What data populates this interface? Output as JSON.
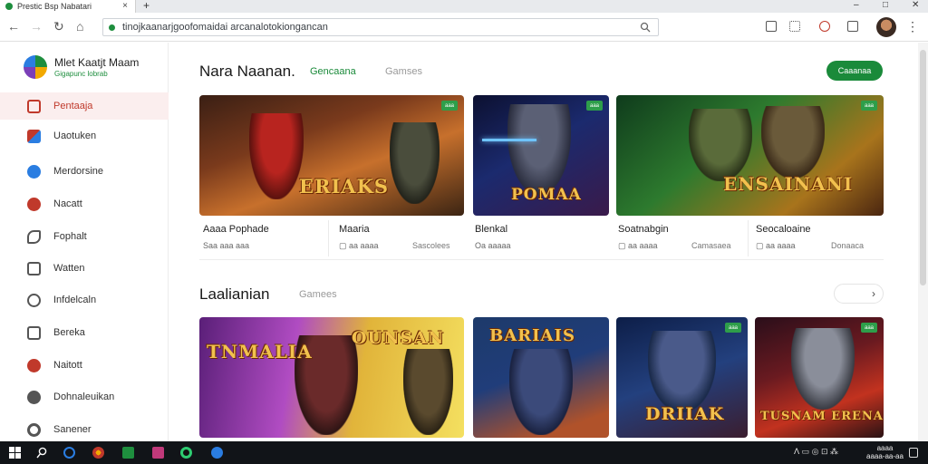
{
  "browser": {
    "tab_title": "Prestic Bsp Nabatari",
    "tab_close": "×",
    "new_tab": "+",
    "url": "tinojkaanarjgoofomaidai arcanalotokiongancan",
    "window_controls": [
      "–",
      "□",
      "✕"
    ],
    "menu_glyph": "⋮"
  },
  "sidebar": {
    "user_name": "Mlet Kaatjt Maam",
    "user_status": "Gigapunc lobrab",
    "items": [
      {
        "label": "Pentaaja",
        "icon": "home-icon",
        "color": "#c0392b"
      },
      {
        "label": "Uaotuken",
        "icon": "app-icon",
        "color": "#2a7de1"
      },
      {
        "label": "Merdorsine",
        "icon": "cloud-icon",
        "color": "#2a7de1"
      },
      {
        "label": "Nacatt",
        "icon": "disc-icon",
        "color": "#c0392b"
      },
      {
        "label": "Fophalt",
        "icon": "send-icon",
        "color": "#555555"
      },
      {
        "label": "Watten",
        "icon": "window-icon",
        "color": "#555555"
      },
      {
        "label": "Infdelcaln",
        "icon": "chat-icon",
        "color": "#555555"
      },
      {
        "label": "Bereka",
        "icon": "phone-icon",
        "color": "#555555"
      },
      {
        "label": "Naitott",
        "icon": "game-icon",
        "color": "#c0392b"
      },
      {
        "label": "Dohnaleuikan",
        "icon": "download-icon",
        "color": "#555555"
      },
      {
        "label": "Sanener",
        "icon": "settings-icon",
        "color": "#555555"
      }
    ]
  },
  "section1": {
    "title": "Nara Naanan.",
    "tab_active": "Gencaana",
    "tab_inactive": "Gamses",
    "button": "Caaanaa",
    "cards": [
      {
        "logo": "ERIAKS",
        "badge": "aaa",
        "title": "Aaaa Pophade",
        "meta": "Saa aaa aaa",
        "meta2": ""
      },
      {
        "logo": "POMAA",
        "badge": "aaa",
        "title": "Maaria",
        "meta": "▢ aa aaaa",
        "meta2": "Sascolees"
      },
      {
        "logo": "ENSAINANI",
        "badge": "aaa",
        "title": "Blenkal",
        "meta": "Oa aaaaa",
        "meta2": ""
      },
      {
        "logo": "",
        "badge": "",
        "title": "Soatnabgin",
        "meta": "▢ aa aaaa",
        "meta2": "Camasaea"
      },
      {
        "logo": "",
        "badge": "",
        "title": "Seocaloaine",
        "meta": "▢ aa aaaa",
        "meta2": "Donaaca"
      }
    ]
  },
  "section2": {
    "title": "Laalianian",
    "tab": "Gamees",
    "pager": "›",
    "cards": [
      {
        "logo": "TNMALIA",
        "logo2": "OUNSAN",
        "badge": ""
      },
      {
        "logo": "BARIAIS",
        "badge": ""
      },
      {
        "logo": "DRIIAK",
        "badge": "aaa"
      },
      {
        "logo": "TUSNAM ERENA",
        "badge": "aaa"
      }
    ]
  },
  "taskbar": {
    "tray_text": "ᐱ  ▭  ◎  ⊡  ⁂",
    "time": "aaaa",
    "date": "aaaa-aa-aa"
  }
}
